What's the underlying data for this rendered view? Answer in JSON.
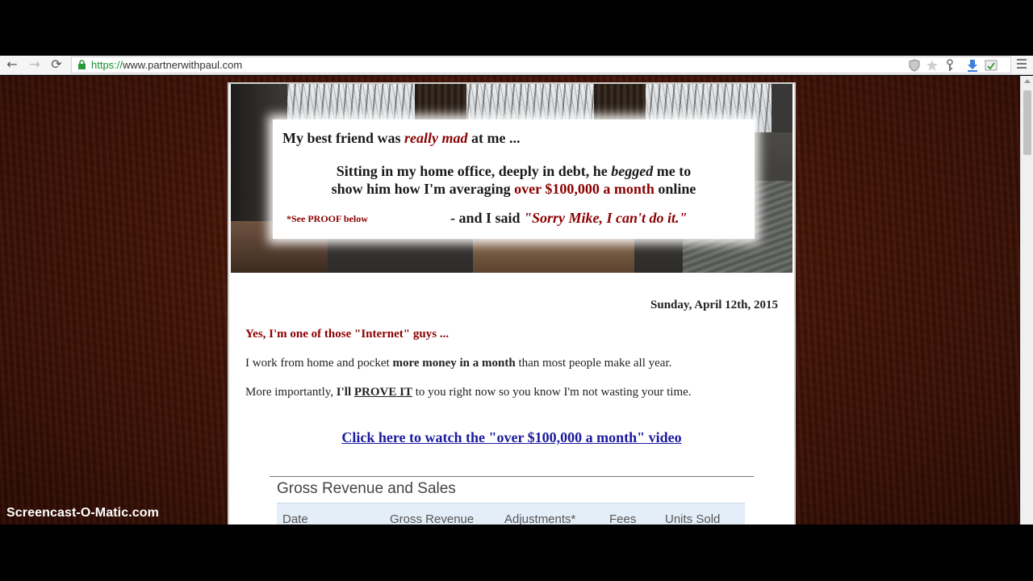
{
  "browser": {
    "url_scheme": "https://",
    "url_host": "www.partnerwithpaul.com",
    "back_glyph": "←",
    "forward_glyph": "→",
    "reload_glyph": "⟳"
  },
  "banner": {
    "line1_start": "My best friend was ",
    "line1_em": "really mad",
    "line1_end": " at me ...",
    "line2_a": "Sitting in my home office, deeply in debt, he ",
    "line2_em": "begged",
    "line2_b": " me to",
    "line3_a": "show him how I'm averaging ",
    "line3_red": "over $100,000 a month",
    "line3_b": " online",
    "proof_note": "*See PROOF below",
    "line4_a": "- and I said ",
    "line4_quote": "\"Sorry Mike, I can't do it.\""
  },
  "content": {
    "date": "Sunday, April 12th, 2015",
    "intro": "Yes, I'm one of those \"Internet\" guys ...",
    "p1_a": "I work from home and pocket ",
    "p1_b": "more money in a month",
    "p1_c": " than most people make all year.",
    "p2_a": "More importantly, ",
    "p2_b": "I'll ",
    "p2_c": "PROVE IT",
    "p2_d": " to you right now so you know I'm not wasting your time.",
    "video_link": "Click here to watch the \"over $100,000 a month\" video"
  },
  "revenue": {
    "title": "Gross Revenue and Sales",
    "columns": [
      "Date",
      "Gross Revenue",
      "Adjustments*",
      "Fees",
      "Units Sold"
    ]
  },
  "watermark": "Screencast-O-Matic.com",
  "colors": {
    "accent_red": "#8b0000",
    "link_blue": "#1b1b9e",
    "page_background": "#4a1608"
  }
}
